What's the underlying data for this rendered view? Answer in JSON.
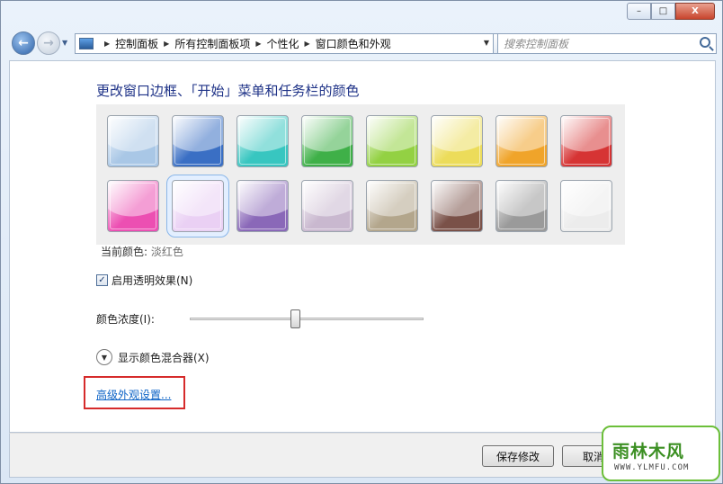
{
  "window": {
    "caption": {
      "minimize_icon": "minimize-icon",
      "maximize_icon": "maximize-icon",
      "close_icon": "close-icon",
      "minimize_glyph": "–",
      "maximize_glyph": "□",
      "close_glyph": "X"
    }
  },
  "nav": {
    "back_glyph": "←",
    "forward_glyph": "→",
    "recent_glyph": "▼",
    "address": {
      "icon": "control-panel-icon",
      "crumbs": [
        "控制面板",
        "所有控制面板项",
        "个性化",
        "窗口颜色和外观"
      ],
      "separator": "▶",
      "dropdown_glyph": "▼"
    },
    "refresh_glyph": "↻",
    "search": {
      "placeholder": "搜索控制面板",
      "icon": "search-icon"
    }
  },
  "main": {
    "title": "更改窗口边框、「开始」菜单和任务栏的颜色",
    "swatches": [
      {
        "name": "sky",
        "color": "#a9c7e6"
      },
      {
        "name": "twilight",
        "color": "#3a6fc4"
      },
      {
        "name": "sea",
        "color": "#38c6c0"
      },
      {
        "name": "leaf",
        "color": "#3fb048"
      },
      {
        "name": "lime",
        "color": "#93d143"
      },
      {
        "name": "pumpkin-light",
        "color": "#ecdc5a"
      },
      {
        "name": "pumpkin",
        "color": "#f0a42a"
      },
      {
        "name": "ruby",
        "color": "#d63434"
      },
      {
        "name": "fuchsia",
        "color": "#ec4fb2"
      },
      {
        "name": "blush",
        "color": "#ead0f4"
      },
      {
        "name": "violet",
        "color": "#8a68b8"
      },
      {
        "name": "lavender",
        "color": "#c9b8cf"
      },
      {
        "name": "taupe",
        "color": "#b3a68c"
      },
      {
        "name": "chocolate",
        "color": "#7a5148"
      },
      {
        "name": "slate",
        "color": "#9a9a9a"
      },
      {
        "name": "frost",
        "color": "#ececec"
      }
    ],
    "selected_swatch_index": 9,
    "current_color_label": "当前颜色:",
    "current_color_value": "淡红色",
    "transparency": {
      "checked": true,
      "check_glyph": "✓",
      "label": "启用透明效果(N)"
    },
    "intensity": {
      "label": "颜色浓度(I):",
      "value_fraction": 0.45
    },
    "mixer": {
      "icon": "chevron-down-icon",
      "glyph": "▼",
      "label": "显示颜色混合器(X)"
    },
    "advanced_link": "高级外观设置..."
  },
  "footer": {
    "save_label": "保存修改",
    "cancel_label": "取消"
  },
  "watermark": {
    "title": "雨林木风",
    "url": "WWW.YLMFU.COM"
  },
  "colors": {
    "title_blue": "#1e3287",
    "link_blue": "#0c63c6",
    "highlight_red": "#d62b2b",
    "watermark_green": "#3b8f22"
  }
}
